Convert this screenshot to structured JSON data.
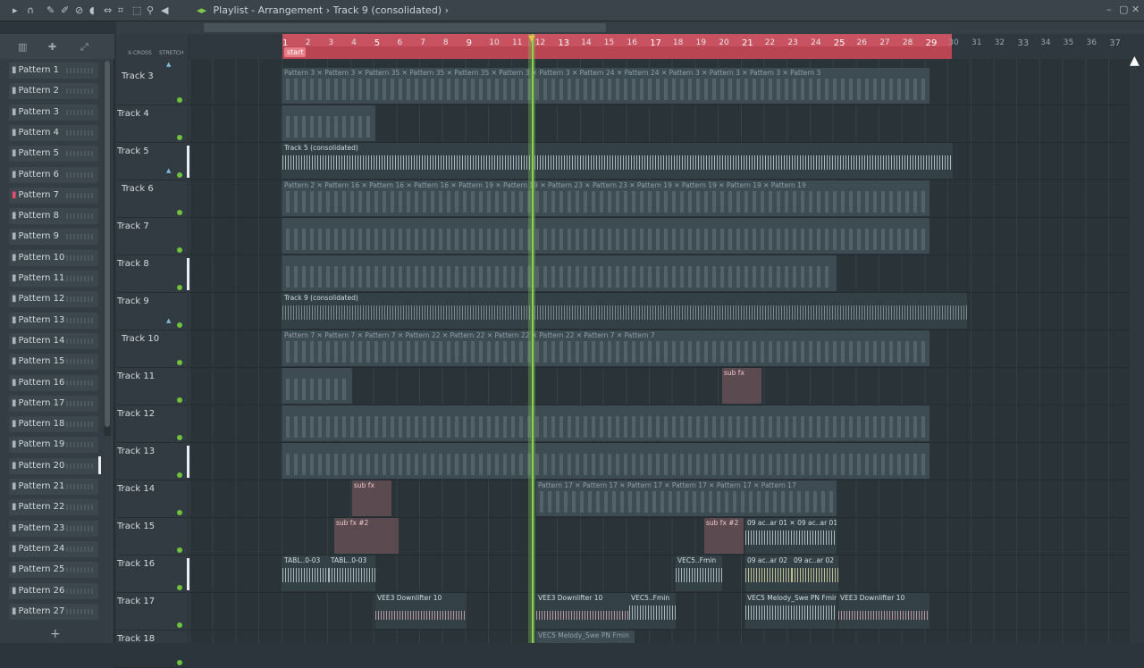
{
  "toolbar": {
    "title": "Playlist - Arrangement",
    "sep": "›",
    "track": "Track 9 (consolidated)",
    "icons": [
      "arrow-icon",
      "magnet-icon",
      "pencil-icon",
      "paint-icon",
      "delete-icon",
      "mute-icon",
      "slip-icon",
      "select-icon",
      "zoom-icon",
      "playback-icon"
    ]
  },
  "browser": {
    "patterns": [
      "Pattern 1",
      "Pattern 2",
      "Pattern 3",
      "Pattern 4",
      "Pattern 5",
      "Pattern 6",
      "Pattern 7",
      "Pattern 8",
      "Pattern 9",
      "Pattern 10",
      "Pattern 11",
      "Pattern 12",
      "Pattern 13",
      "Pattern 14",
      "Pattern 15",
      "Pattern 16",
      "Pattern 17",
      "Pattern 18",
      "Pattern 19",
      "Pattern 20",
      "Pattern 21",
      "Pattern 22",
      "Pattern 23",
      "Pattern 24",
      "Pattern 25",
      "Pattern 26",
      "Pattern 27"
    ],
    "selected_index": 6,
    "add_label": "+"
  },
  "header": {
    "xfade": "X-CROSS",
    "stretch": "STRETCH"
  },
  "tracks": [
    "Track 3",
    "Track 4",
    "Track 5",
    "Track 6",
    "Track 7",
    "Track 8",
    "Track 9",
    "Track 10",
    "Track 11",
    "Track 12",
    "Track 13",
    "Track 14",
    "Track 15",
    "Track 16",
    "Track 17",
    "Track 18"
  ],
  "timeline": {
    "bars": [
      "1",
      "2",
      "3",
      "4",
      "5",
      "6",
      "7",
      "8",
      "9",
      "10",
      "11",
      "12",
      "13",
      "14",
      "15",
      "16",
      "17",
      "18",
      "19",
      "20",
      "21",
      "22",
      "23",
      "24",
      "25",
      "26",
      "27",
      "28",
      "29",
      "30",
      "31",
      "32",
      "33",
      "34",
      "35",
      "36",
      "37"
    ],
    "marker": "start"
  },
  "clips": {
    "track3_labels": "Pattern 3 ✕ Pattern 3 ✕ Pattern 35 ✕ Pattern 35 ✕ Pattern 35 ✕ Pattern 3 ✕ Pattern 3 ✕ Pattern 24 ✕ Pattern 24 ✕ Pattern 3 ✕ Pattern 3 ✕ Pattern 3 ✕ Pattern 3",
    "track5": "Track 5 (consolidated)",
    "track6_labels": "Pattern 2 ✕ Pattern 16 ✕ Pattern 16 ✕ Pattern 16 ✕ Pattern 19 ✕ Pattern 19 ✕ Pattern 23 ✕ Pattern 23 ✕ Pattern 19 ✕ Pattern 19 ✕ Pattern 19 ✕ Pattern 19",
    "track9": "Track 9 (consolidated)",
    "track10_labels": "Pattern 7 ✕ Pattern 7 ✕ Pattern 7 ✕ Pattern 22 ✕ Pattern 22 ✕ Pattern 22 ✕ Pattern 22 ✕ Pattern 7 ✕ Pattern 7",
    "track11_fx": "sub fx",
    "track14_fx": "sub fx",
    "track14_labels": "Pattern 17 ✕ Pattern 17 ✕ Pattern 17 ✕ Pattern 17 ✕ Pattern 17 ✕ Pattern 17",
    "track15_fx1": "sub fx #2",
    "track15_fx2": "sub fx #2",
    "track15_audio": "09 ac..ar 01 ✕ 09 ac..ar 01",
    "track16_a": "TABL..0-03",
    "track16_b": "TABL..0-03",
    "track16_c": "VEC5..Fmin",
    "track16_d": "09 ac..ar 02",
    "track16_e": "09 ac..ar 02",
    "track17_a": "VEE3 Downlifter 10",
    "track17_b": "VEE3 Downlifter 10",
    "track17_c": "VEC5..Fmin",
    "track17_d": "VEC5 Melody_Swe PN Fmin",
    "track17_e": "VEE3 Downlifter 10",
    "track18_label": "VEC5 Melody_Swe PN Fmin"
  }
}
